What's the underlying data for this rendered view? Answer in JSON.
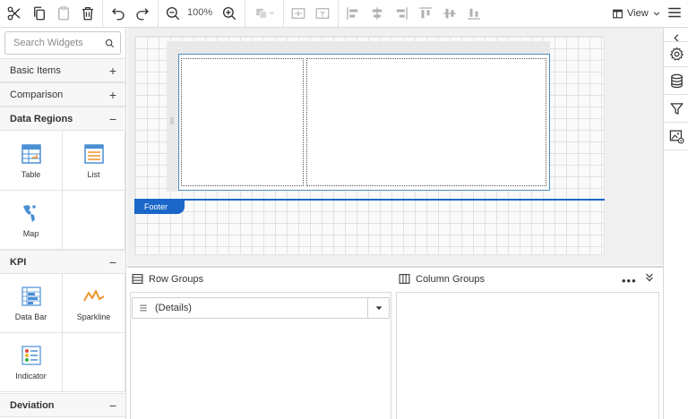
{
  "toolbar": {
    "zoom": "100%",
    "view_label": "View"
  },
  "sidebar": {
    "search_placeholder": "Search Widgets",
    "categories": {
      "basic": {
        "label": "Basic Items",
        "sign": "+"
      },
      "comparison": {
        "label": "Comparison",
        "sign": "+"
      },
      "data_regions": {
        "label": "Data Regions",
        "sign": "−"
      },
      "kpi": {
        "label": "KPI",
        "sign": "−"
      },
      "deviation": {
        "label": "Deviation",
        "sign": "−"
      }
    },
    "widgets": {
      "table": "Table",
      "list": "List",
      "map": "Map",
      "data_bar": "Data Bar",
      "sparkline": "Sparkline",
      "indicator": "Indicator"
    }
  },
  "canvas": {
    "footer_label": "Footer"
  },
  "groups": {
    "row_groups": "Row Groups",
    "column_groups": "Column Groups",
    "details": "(Details)",
    "more": "•••"
  },
  "colors": {
    "accent": "#1a67c9",
    "selection": "#4a90c8"
  }
}
